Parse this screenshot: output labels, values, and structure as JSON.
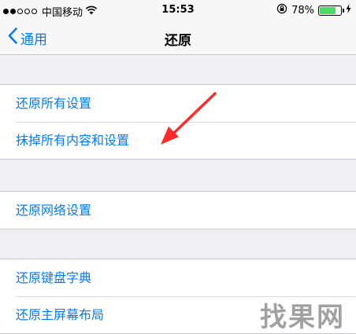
{
  "status_bar": {
    "carrier": "中国移动",
    "time": "15:53",
    "battery_percent": "78%",
    "battery_level": 0.78,
    "signal_filled": 2,
    "signal_total": 5
  },
  "nav": {
    "back_label": "通用",
    "title": "还原"
  },
  "groups": [
    {
      "items": [
        "还原所有设置",
        "抹掉所有内容和设置"
      ]
    },
    {
      "items": [
        "还原网络设置"
      ]
    },
    {
      "items": [
        "还原键盘字典",
        "还原主屏幕布局"
      ]
    }
  ],
  "watermark": "找果网",
  "colors": {
    "accent": "#007aff",
    "arrow": "#ff2a2a",
    "battery": "#4cd964",
    "background": "#efeff4"
  }
}
